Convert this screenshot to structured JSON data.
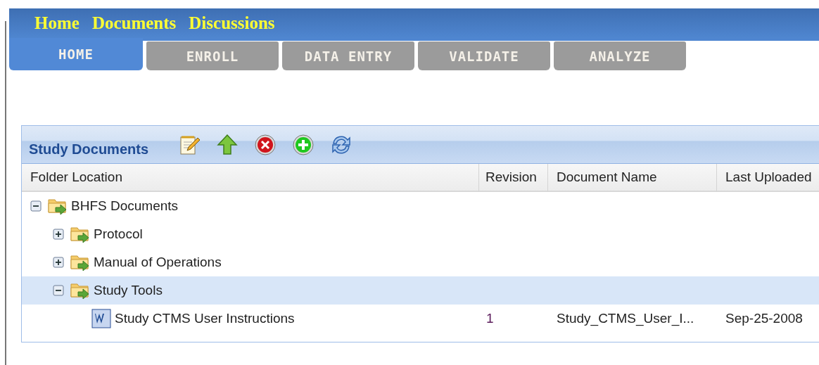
{
  "top_links": [
    "Home",
    "Documents",
    "Discussions"
  ],
  "tabs": [
    {
      "label": "HOME",
      "selected": true
    },
    {
      "label": "ENROLL",
      "selected": false
    },
    {
      "label": "DATA ENTRY",
      "selected": false
    },
    {
      "label": "VALIDATE",
      "selected": false
    },
    {
      "label": "ANALYZE",
      "selected": false
    }
  ],
  "panel": {
    "title": "Study Documents",
    "columns": [
      "Folder Location",
      "Revision",
      "Document Name",
      "Last Uploaded"
    ],
    "tree": [
      {
        "kind": "folder",
        "name": "BHFS Documents",
        "expanded": true,
        "selected": false,
        "children": [
          {
            "kind": "folder",
            "name": "Protocol",
            "expanded": false,
            "selected": false
          },
          {
            "kind": "folder",
            "name": "Manual of Operations",
            "expanded": false,
            "selected": false
          },
          {
            "kind": "folder",
            "name": "Study Tools",
            "expanded": true,
            "selected": true,
            "children": [
              {
                "kind": "document",
                "name": "Study CTMS User Instructions",
                "selected": false,
                "revision": "1",
                "document_name": "Study_CTMS_User_I...",
                "last_uploaded": "Sep-25-2008"
              }
            ]
          }
        ]
      }
    ]
  }
}
